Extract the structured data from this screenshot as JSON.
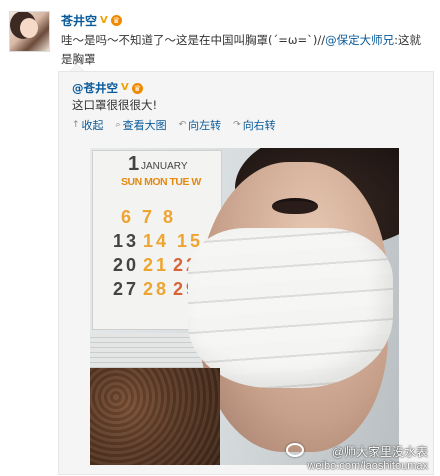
{
  "post": {
    "author": "苍井空",
    "text_prefix": "哇～是吗～不知道了～这是在中国叫胸罩(´=ω=`)//",
    "mention": "@保定大师兄",
    "text_suffix": ":这就是胸罩"
  },
  "badges": {
    "verified": "V",
    "crown": "♛"
  },
  "repost": {
    "author": "@苍井空",
    "text": "这口罩很很很大!"
  },
  "image_tools": {
    "collapse": "收起",
    "view_large": "查看大图",
    "rotate_left": "向左转",
    "rotate_right": "向右转"
  },
  "icons": {
    "collapse": "collapse-arrow-icon",
    "view_large": "magnify-icon",
    "rotate_left": "rotate-left-icon",
    "rotate_right": "rotate-right-icon"
  },
  "calendar": {
    "month_num": "1",
    "month": "JANUARY",
    "days": "SUN MON TUE W",
    "row1": "6 7 8",
    "row2a": "13",
    "row2b": "14 15",
    "row3a": "20",
    "row3b": "21",
    "row3c": "22",
    "row4a": "27",
    "row4b": "28",
    "row4c": "29"
  },
  "watermark": {
    "handle": "@师大家里没水表",
    "url": "weibo.com/laoshitoumax"
  },
  "colors": {
    "link": "#0a5a99",
    "badge_gold": "#f2a100",
    "box_bg": "#f5f5f5"
  }
}
